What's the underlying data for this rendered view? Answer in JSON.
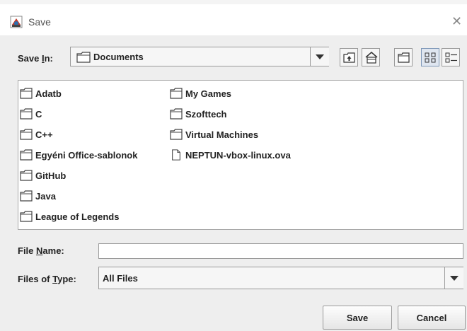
{
  "dialog": {
    "title": "Save"
  },
  "save_in": {
    "label_pre": "Save ",
    "label_mnemonic": "I",
    "label_post": "n:",
    "value": "Documents"
  },
  "toolbar": {
    "icons": [
      "up-one-level-icon",
      "home-icon",
      "new-folder-icon",
      "list-view-icon",
      "details-view-icon"
    ],
    "selected_view": "list"
  },
  "files": {
    "column1": [
      "Adatb",
      "C",
      "C++",
      "Egyéni Office-sablonok",
      "GitHub",
      "Java",
      "League of Legends"
    ],
    "column2": [
      "My Games",
      "Szofttech",
      "Virtual Machines",
      "NEPTUN-vbox-linux.ova"
    ],
    "column2_types": [
      "folder",
      "folder",
      "folder",
      "file"
    ]
  },
  "file_name": {
    "label_pre": "File ",
    "label_mnemonic": "N",
    "label_post": "ame:",
    "value": ""
  },
  "file_type": {
    "label_pre": "Files of ",
    "label_mnemonic": "T",
    "label_post": "ype:",
    "value": "All Files"
  },
  "buttons": {
    "save": "Save",
    "cancel": "Cancel"
  }
}
